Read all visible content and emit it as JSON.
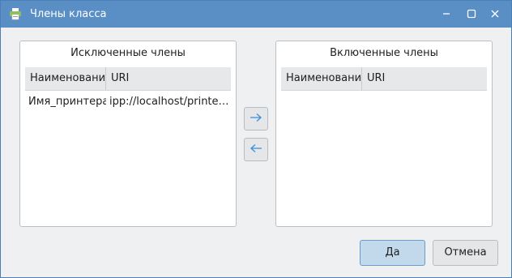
{
  "window": {
    "title": "Члены класса"
  },
  "excluded_panel": {
    "title": "Исключенные члены",
    "columns": [
      "Наименовани",
      "URI"
    ],
    "rows": [
      {
        "name": "Имя_принтера",
        "uri": "ipp://localhost/printers..."
      }
    ]
  },
  "included_panel": {
    "title": "Включенные члены",
    "columns": [
      "Наименовани",
      "URI"
    ],
    "rows": []
  },
  "buttons": {
    "ok_label": "Да",
    "cancel_label": "Отмена"
  },
  "icons": {
    "app": "printer-icon",
    "move_right": "arrow-right-icon",
    "move_left": "arrow-left-icon",
    "minimize": "minimize-icon",
    "maximize": "maximize-icon",
    "close": "close-icon"
  },
  "colors": {
    "titlebar": "#5a8fc6",
    "accent_button": "#c2d9ec",
    "arrow": "#3b8fd9"
  }
}
